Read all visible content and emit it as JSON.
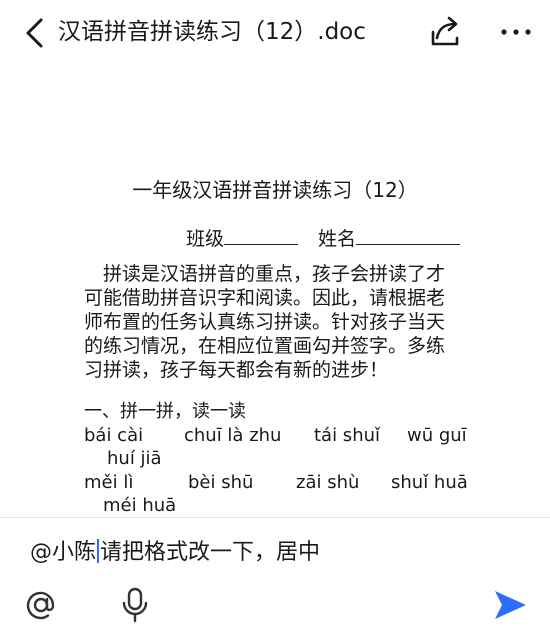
{
  "header": {
    "title": "汉语拼音拼读练习（12）.doc",
    "icons": {
      "back": "back-icon",
      "share": "share-icon",
      "more": "more-icon"
    }
  },
  "document": {
    "title": "一年级汉语拼音拼读练习（12）",
    "class_label": "班级",
    "name_label": "姓名",
    "paragraph_lines": [
      "拼读是汉语拼音的重点，孩子会拼读了才",
      "可能借助拼音识字和阅读。因此，请根据老",
      "师布置的任务认真练习拼读。针对孩子当天",
      "的练习情况，在相应位置画勾并签字。多练",
      "习拼读，孩子每天都会有新的进步！"
    ],
    "section_heading": "一、拼一拼，读一读",
    "pinyin_words": [
      "bái cài",
      "chuī là zhu",
      "tái shuǐ",
      "wū guī",
      "huí jiā",
      "měi lì",
      "bèi shū",
      "zāi shù",
      "shuǐ huā",
      "méi huā"
    ]
  },
  "input": {
    "mention": "@小陈",
    "value": "请把格式改一下，居中",
    "icons": {
      "at": "at-icon",
      "mic": "microphone-icon",
      "send": "send-icon"
    },
    "send_color": "#2f6bff"
  }
}
